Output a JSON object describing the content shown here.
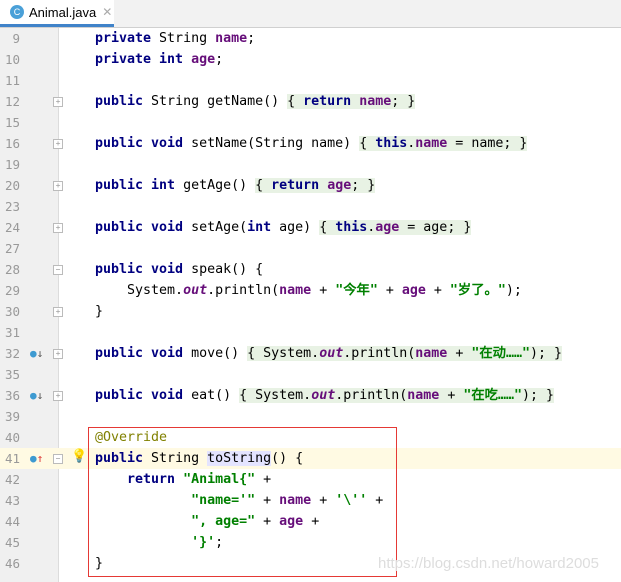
{
  "tab": {
    "label": "Animal.java",
    "icon": "C"
  },
  "watermark": "https://blog.csdn.net/howard2005",
  "lines": [
    {
      "n": "9",
      "t": [
        [
          "private ",
          "kw"
        ],
        [
          "String ",
          ""
        ],
        [
          "name",
          "fd"
        ],
        [
          ";",
          ""
        ]
      ]
    },
    {
      "n": "10",
      "t": [
        [
          "private int ",
          "kw"
        ],
        [
          "age",
          "fd"
        ],
        [
          ";",
          ""
        ]
      ]
    },
    {
      "n": "11",
      "t": []
    },
    {
      "n": "12",
      "fold": true,
      "t": [
        [
          "public ",
          "kw"
        ],
        [
          "String getName() ",
          ""
        ],
        [
          "{ ",
          "fb"
        ],
        [
          "return ",
          "kw fb"
        ],
        [
          "name",
          "fd fb"
        ],
        [
          "; }",
          "fb"
        ]
      ]
    },
    {
      "n": "15",
      "t": []
    },
    {
      "n": "16",
      "fold": true,
      "t": [
        [
          "public void ",
          "kw"
        ],
        [
          "setName(String name) ",
          ""
        ],
        [
          "{ ",
          "fb"
        ],
        [
          "this",
          "kw fb"
        ],
        [
          ".",
          "fb"
        ],
        [
          "name",
          "fd fb"
        ],
        [
          " = name; }",
          "fb"
        ]
      ]
    },
    {
      "n": "19",
      "t": []
    },
    {
      "n": "20",
      "fold": true,
      "t": [
        [
          "public int ",
          "kw"
        ],
        [
          "getAge() ",
          ""
        ],
        [
          "{ ",
          "fb"
        ],
        [
          "return ",
          "kw fb"
        ],
        [
          "age",
          "fd fb"
        ],
        [
          "; }",
          "fb"
        ]
      ]
    },
    {
      "n": "23",
      "t": []
    },
    {
      "n": "24",
      "fold": true,
      "t": [
        [
          "public void ",
          "kw"
        ],
        [
          "setAge(",
          ""
        ],
        [
          "int ",
          "kw"
        ],
        [
          "age) ",
          ""
        ],
        [
          "{ ",
          "fb"
        ],
        [
          "this",
          "kw fb"
        ],
        [
          ".",
          "fb"
        ],
        [
          "age",
          "fd fb"
        ],
        [
          " = age; }",
          "fb"
        ]
      ]
    },
    {
      "n": "27",
      "t": []
    },
    {
      "n": "28",
      "fold": true,
      "t": [
        [
          "public void ",
          "kw"
        ],
        [
          "speak() {",
          ""
        ]
      ]
    },
    {
      "n": "29",
      "t": [
        [
          "    System.",
          ""
        ],
        [
          "out",
          "it"
        ],
        [
          ".println(",
          ""
        ],
        [
          "name",
          "fd"
        ],
        [
          " + ",
          ""
        ],
        [
          "\"今年\"",
          "st"
        ],
        [
          " + ",
          ""
        ],
        [
          "age",
          "fd"
        ],
        [
          " + ",
          ""
        ],
        [
          "\"岁了。\"",
          "st"
        ],
        [
          ");",
          ""
        ]
      ]
    },
    {
      "n": "30",
      "fold": true,
      "t": [
        [
          "}",
          ""
        ]
      ]
    },
    {
      "n": "31",
      "t": []
    },
    {
      "n": "32",
      "fold": true,
      "mark": "down",
      "t": [
        [
          "public void ",
          "kw"
        ],
        [
          "move() ",
          ""
        ],
        [
          "{ ",
          "fb"
        ],
        [
          "System.",
          "fb"
        ],
        [
          "out",
          "it fb"
        ],
        [
          ".println(",
          "fb"
        ],
        [
          "name",
          "fd fb"
        ],
        [
          " + ",
          "fb"
        ],
        [
          "\"在动……\"",
          "st fb"
        ],
        [
          "); }",
          "fb"
        ]
      ]
    },
    {
      "n": "35",
      "t": []
    },
    {
      "n": "36",
      "fold": true,
      "mark": "down",
      "t": [
        [
          "public void ",
          "kw"
        ],
        [
          "eat() ",
          ""
        ],
        [
          "{ ",
          "fb"
        ],
        [
          "System.",
          "fb"
        ],
        [
          "out",
          "it fb"
        ],
        [
          ".println(",
          "fb"
        ],
        [
          "name",
          "fd fb"
        ],
        [
          " + ",
          "fb"
        ],
        [
          "\"在吃……\"",
          "st fb"
        ],
        [
          "); }",
          "fb"
        ]
      ]
    },
    {
      "n": "39",
      "t": []
    },
    {
      "n": "40",
      "t": [
        [
          "@Override",
          "an"
        ]
      ]
    },
    {
      "n": "41",
      "hl": true,
      "fold": true,
      "mark": "up",
      "bulb": true,
      "t": [
        [
          "public ",
          "kw"
        ],
        [
          "String ",
          ""
        ],
        [
          "toString",
          "sel"
        ],
        [
          "() {",
          ""
        ]
      ]
    },
    {
      "n": "42",
      "t": [
        [
          "    ",
          ""
        ],
        [
          "return ",
          "kw"
        ],
        [
          "\"Animal{\"",
          "st"
        ],
        [
          " +",
          ""
        ]
      ]
    },
    {
      "n": "43",
      "t": [
        [
          "            ",
          ""
        ],
        [
          "\"name='\"",
          "st"
        ],
        [
          " + ",
          ""
        ],
        [
          "name",
          "fd"
        ],
        [
          " + ",
          ""
        ],
        [
          "'\\''",
          "st"
        ],
        [
          " +",
          ""
        ]
      ]
    },
    {
      "n": "44",
      "t": [
        [
          "            ",
          ""
        ],
        [
          "\", age=\"",
          "st"
        ],
        [
          " + ",
          ""
        ],
        [
          "age",
          "fd"
        ],
        [
          " +",
          ""
        ]
      ]
    },
    {
      "n": "45",
      "t": [
        [
          "            ",
          ""
        ],
        [
          "'}'",
          "st"
        ],
        [
          ";",
          ""
        ]
      ]
    },
    {
      "n": "46",
      "t": [
        [
          "}",
          ""
        ]
      ]
    }
  ]
}
